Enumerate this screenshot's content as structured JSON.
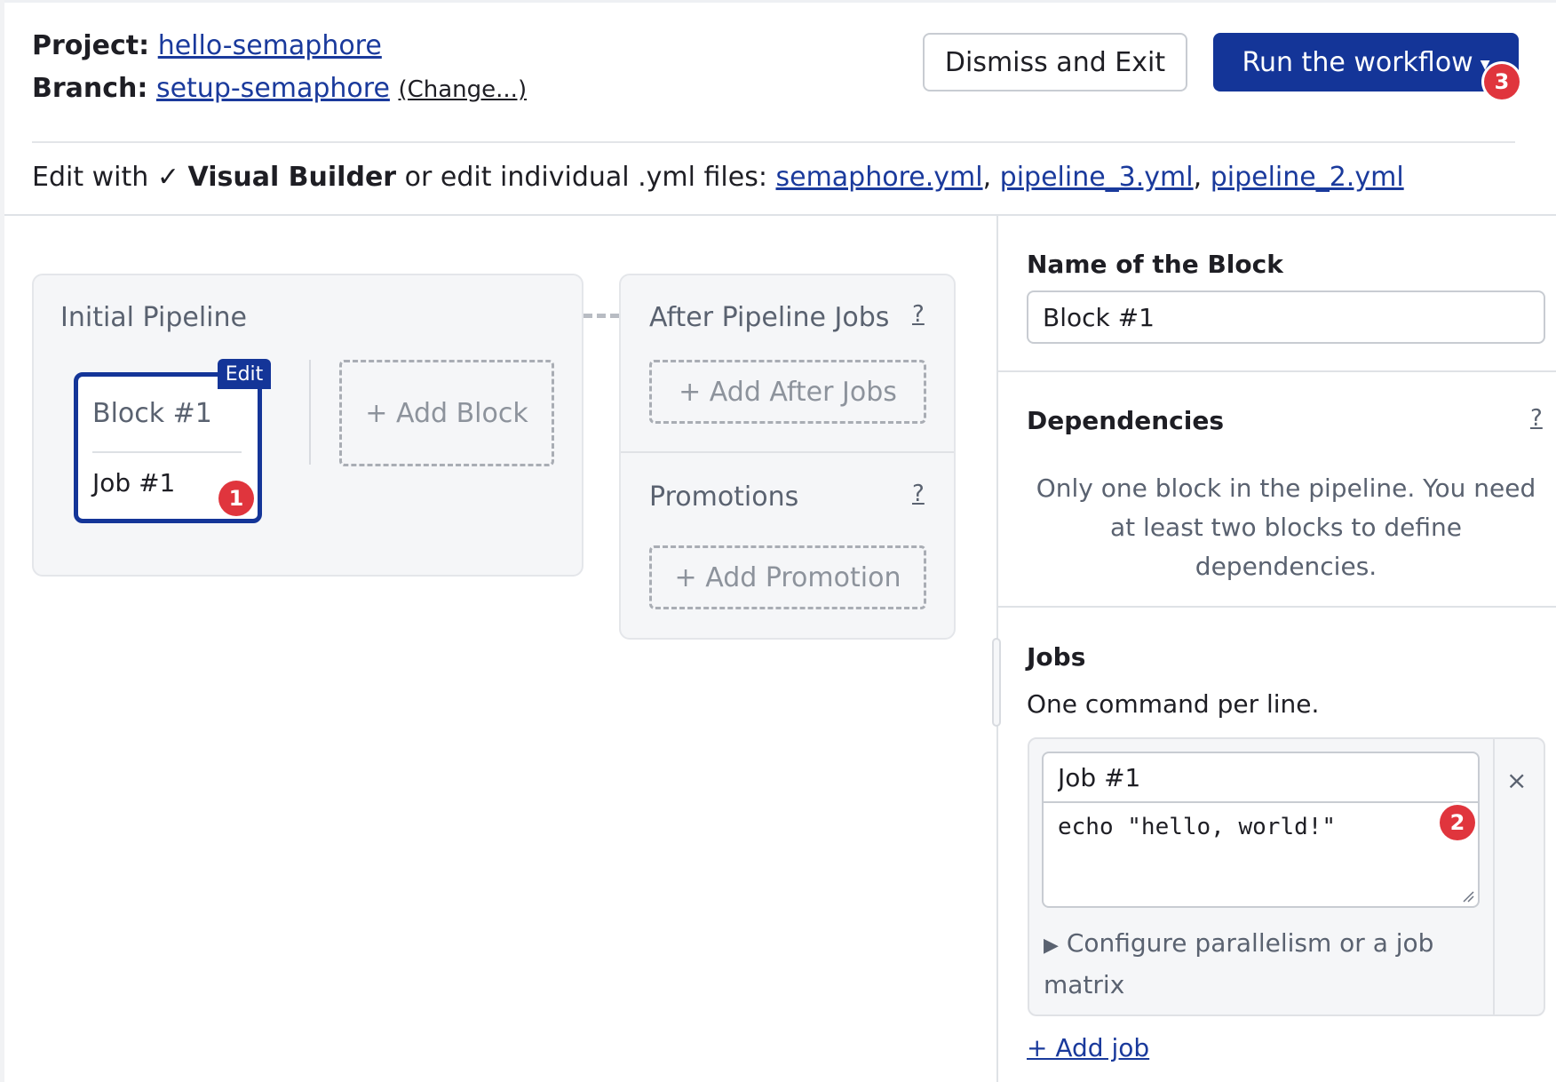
{
  "header": {
    "project_label": "Project:",
    "project_name": "hello-semaphore",
    "branch_label": "Branch:",
    "branch_name": "setup-semaphore",
    "change_link": "(Change...)",
    "dismiss_button": "Dismiss and Exit",
    "run_button": "Run the workflow",
    "run_badge": "3"
  },
  "edit_bar": {
    "prefix": "Edit with",
    "check": "✓",
    "visual_builder": "Visual Builder",
    "middle": "or edit individual .yml files:",
    "files": [
      "semaphore.yml",
      "pipeline_3.yml",
      "pipeline_2.yml"
    ]
  },
  "pipeline": {
    "title": "Initial Pipeline",
    "block": {
      "edit_tab": "Edit",
      "name": "Block #1",
      "job": "Job #1",
      "badge": "1"
    },
    "add_block": "+ Add Block"
  },
  "after_pipeline": {
    "title": "After Pipeline Jobs",
    "help": "?",
    "add_after_jobs": "+ Add After Jobs",
    "promotions_title": "Promotions",
    "promotions_help": "?",
    "add_promotion": "+ Add Promotion"
  },
  "right_panel": {
    "name_title": "Name of the Block",
    "name_value": "Block #1",
    "dependencies_title": "Dependencies",
    "dependencies_help": "?",
    "dependencies_text": "Only one block in the pipeline. You need at least two blocks to define dependencies.",
    "jobs_title": "Jobs",
    "jobs_subtitle": "One command per line.",
    "job": {
      "name": "Job #1",
      "command": "echo \"hello, world!\"",
      "badge": "2",
      "close": "×",
      "configure": "Configure parallelism or a job matrix",
      "configure_arrow": "▶"
    },
    "add_job": "+ Add job"
  }
}
